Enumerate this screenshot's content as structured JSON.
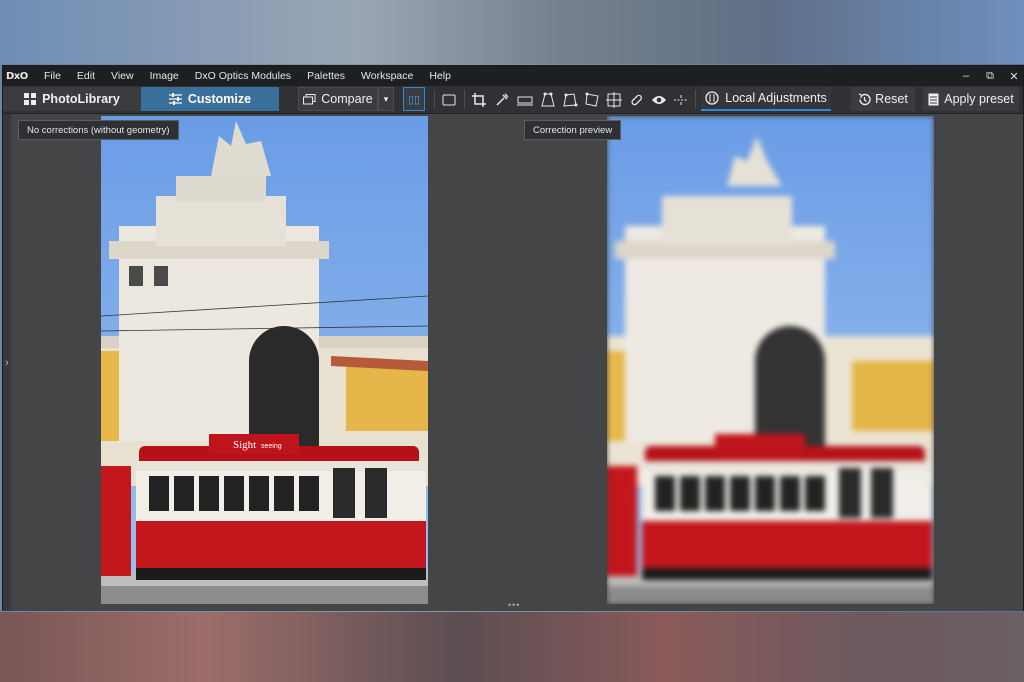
{
  "menu": {
    "logo": "DxO",
    "items": [
      "File",
      "Edit",
      "View",
      "Image",
      "DxO Optics Modules",
      "Palettes",
      "Workspace",
      "Help"
    ]
  },
  "window_controls": {
    "minimize": "–",
    "restore": "⧉",
    "close": "✕"
  },
  "toolbar": {
    "photolibrary_label": "PhotoLibrary",
    "customize_label": "Customize",
    "compare_label": "Compare",
    "compare_dropdown": "▾",
    "split_view_label": "▯▯",
    "local_adjustments_label": "Local Adjustments",
    "reset_label": "Reset",
    "apply_preset_label": "Apply preset",
    "tool_icons": [
      "crop-icon",
      "picker-icon",
      "horizon-icon",
      "perspective-icon",
      "volume-deformation-icon",
      "keystone-icon",
      "grid-icon",
      "repair-icon",
      "red-eye-icon",
      "straighten-icon"
    ]
  },
  "viewer": {
    "left_tooltip": "No corrections (without geometry)",
    "right_tooltip": "Correction preview",
    "side_handle": "›",
    "bottom_handle": "•••",
    "tram_sign_1": "Sight",
    "tram_sign_2": "seeing"
  },
  "colors": {
    "accent": "#2e8ad6",
    "customize_bg": "#3a6f9b",
    "sky": "#6f9fe0",
    "tram_red": "#c3161d"
  }
}
